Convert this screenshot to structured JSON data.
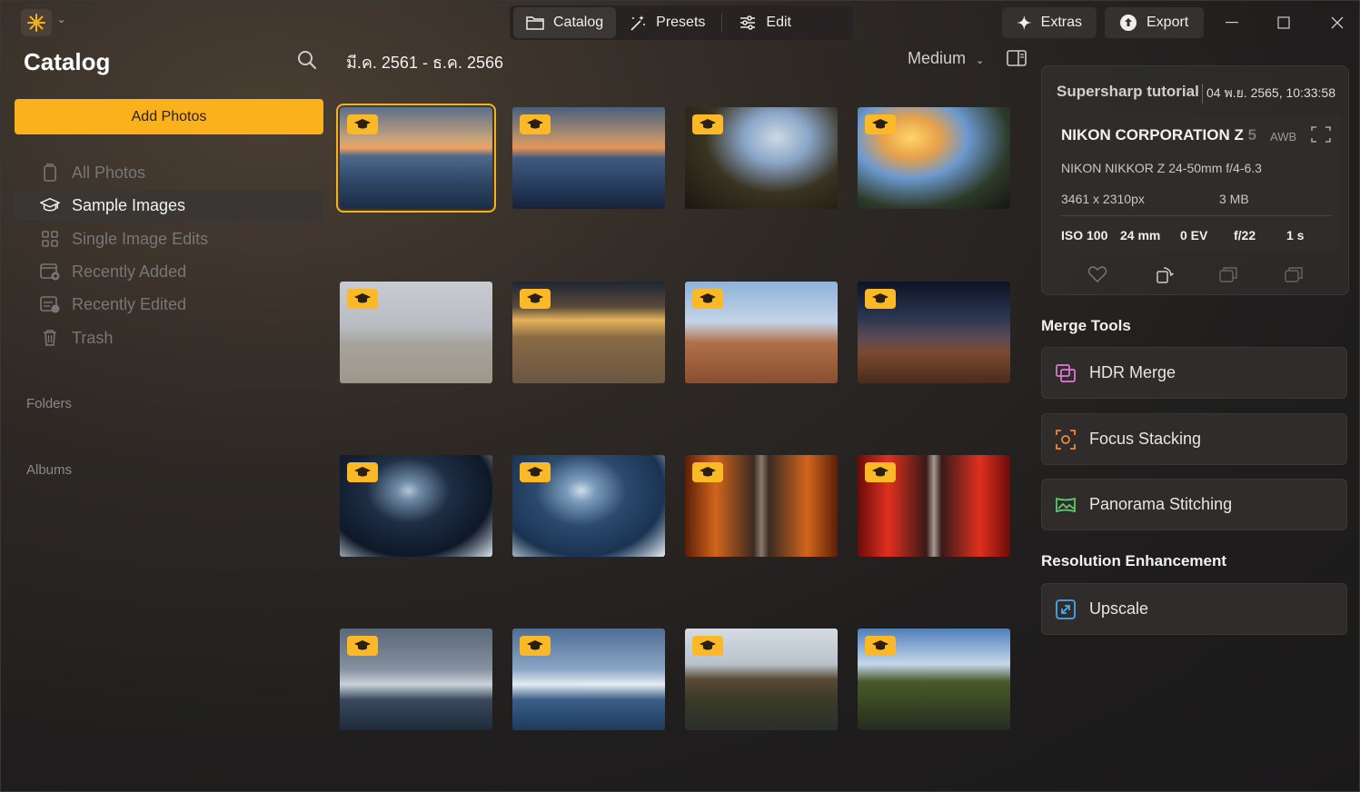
{
  "titlebar": {
    "nav": [
      {
        "label": "Catalog",
        "icon": "folder-icon",
        "active": true
      },
      {
        "label": "Presets",
        "icon": "magic-wand-icon",
        "active": false
      },
      {
        "label": "Edit",
        "icon": "sliders-icon",
        "active": false
      }
    ],
    "extras_label": "Extras",
    "export_label": "Export"
  },
  "sidebar": {
    "title": "Catalog",
    "add_photos": "Add Photos",
    "items": [
      {
        "label": "All Photos",
        "icon": "phone-icon"
      },
      {
        "label": "Sample Images",
        "icon": "graduation-cap-icon"
      },
      {
        "label": "Single Image Edits",
        "icon": "grid-icon"
      },
      {
        "label": "Recently Added",
        "icon": "calendar-add-icon"
      },
      {
        "label": "Recently Edited",
        "icon": "calendar-edit-icon"
      },
      {
        "label": "Trash",
        "icon": "trash-icon"
      }
    ],
    "folders_label": "Folders",
    "albums_label": "Albums"
  },
  "grid": {
    "date_range": "มี.ค. 2561 - ธ.ค. 2566",
    "size": "Medium",
    "thumbnails": [
      {
        "scene": "iceberg-sunset-1",
        "selected": true
      },
      {
        "scene": "iceberg-sunset-2"
      },
      {
        "scene": "waterfall-cave-1"
      },
      {
        "scene": "waterfall-cave-2"
      },
      {
        "scene": "beach-fog-1"
      },
      {
        "scene": "beach-sunset-2"
      },
      {
        "scene": "rock-arch-1"
      },
      {
        "scene": "rock-arch-night-2"
      },
      {
        "scene": "ice-cave-1"
      },
      {
        "scene": "ice-cave-2"
      },
      {
        "scene": "torii-gates-1"
      },
      {
        "scene": "torii-gates-2"
      },
      {
        "scene": "glacier-lagoon-1"
      },
      {
        "scene": "glacier-lagoon-2"
      },
      {
        "scene": "kirkjufell-1"
      },
      {
        "scene": "kirkjufell-2"
      }
    ]
  },
  "info": {
    "title": "Supersharp tutorial",
    "date": "04 พ.ย. 2565, 10:33:58",
    "camera": "NIKON CORPORATION Z",
    "camera_model": "5",
    "awb": "AWB",
    "lens": "NIKON NIKKOR Z 24-50mm f/4-6.3",
    "dimensions": "3461 x 2310px",
    "filesize": "3 MB",
    "iso": "ISO 100",
    "focal": "24 mm",
    "ev": "0 EV",
    "aperture": "f/22",
    "shutter": "1 s"
  },
  "tools": {
    "merge_title": "Merge Tools",
    "merge": [
      "HDR Merge",
      "Focus Stacking",
      "Panorama Stitching"
    ],
    "resolution_title": "Resolution Enhancement",
    "resolution": [
      "Upscale"
    ]
  },
  "colors": {
    "accent": "#fbb11b",
    "panel": "#2f2c2b"
  }
}
